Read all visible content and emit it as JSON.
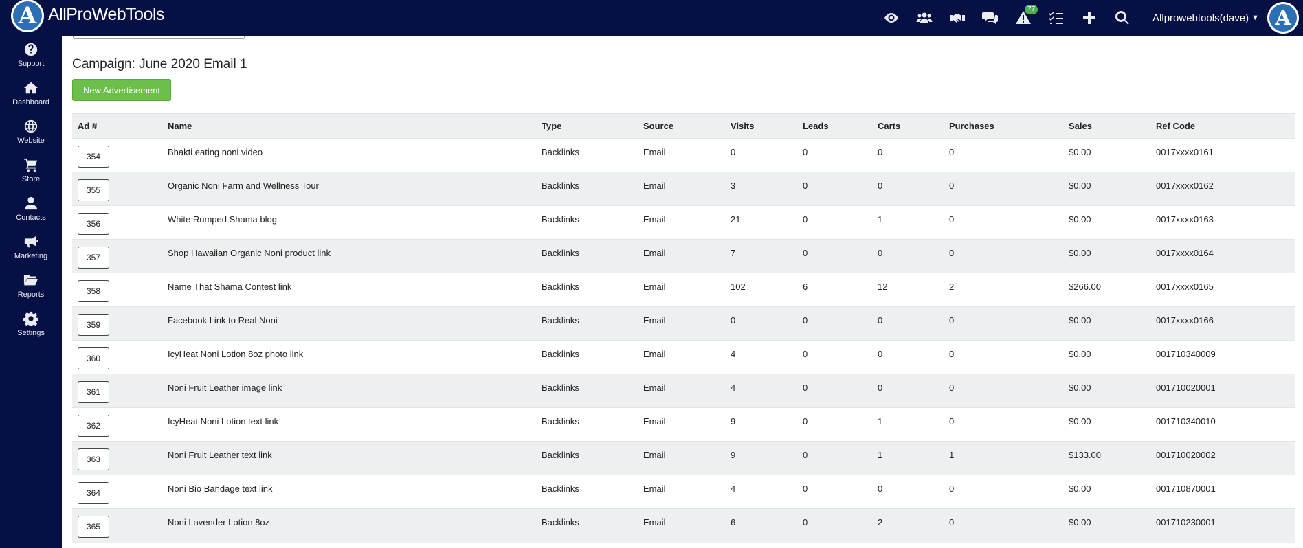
{
  "app": {
    "logo_text": "AllProWebTools",
    "logo_letter": "A"
  },
  "topbar": {
    "icons": [
      "eye-icon",
      "users-icon",
      "handshake-icon",
      "comments-icon",
      "alert-icon",
      "tasks-icon",
      "plus-icon",
      "search-icon"
    ],
    "alert_count": "77",
    "user_label": "Allprowebtools(dave)",
    "caret": "⌄"
  },
  "sidebar": {
    "items": [
      {
        "label": "Support",
        "icon": "question-circle-icon"
      },
      {
        "label": "Dashboard",
        "icon": "home-icon"
      },
      {
        "label": "Website",
        "icon": "globe-icon"
      },
      {
        "label": "Store",
        "icon": "cart-icon"
      },
      {
        "label": "Contacts",
        "icon": "user-icon"
      },
      {
        "label": "Marketing",
        "icon": "megaphone-icon"
      },
      {
        "label": "Reports",
        "icon": "folder-open-icon"
      },
      {
        "label": "Settings",
        "icon": "gear-icon"
      }
    ]
  },
  "page": {
    "title": "Campaign: June 2020 Email 1",
    "new_button": "New Advertisement"
  },
  "table": {
    "headers": [
      "Ad #",
      "Name",
      "Type",
      "Source",
      "Visits",
      "Leads",
      "Carts",
      "Purchases",
      "Sales",
      "Ref Code"
    ],
    "rows": [
      {
        "ad": "354",
        "name": "Bhakti eating noni video",
        "type": "Backlinks",
        "source": "Email",
        "visits": "0",
        "leads": "0",
        "carts": "0",
        "purchases": "0",
        "sales": "$0.00",
        "ref": "0017xxxx0161"
      },
      {
        "ad": "355",
        "name": "Organic Noni Farm and Wellness Tour",
        "type": "Backlinks",
        "source": "Email",
        "visits": "3",
        "leads": "0",
        "carts": "0",
        "purchases": "0",
        "sales": "$0.00",
        "ref": "0017xxxx0162"
      },
      {
        "ad": "356",
        "name": "White Rumped Shama blog",
        "type": "Backlinks",
        "source": "Email",
        "visits": "21",
        "leads": "0",
        "carts": "1",
        "purchases": "0",
        "sales": "$0.00",
        "ref": "0017xxxx0163"
      },
      {
        "ad": "357",
        "name": "Shop Hawaiian Organic Noni product link",
        "type": "Backlinks",
        "source": "Email",
        "visits": "7",
        "leads": "0",
        "carts": "0",
        "purchases": "0",
        "sales": "$0.00",
        "ref": "0017xxxx0164"
      },
      {
        "ad": "358",
        "name": "Name That Shama Contest link",
        "type": "Backlinks",
        "source": "Email",
        "visits": "102",
        "leads": "6",
        "carts": "12",
        "purchases": "2",
        "sales": "$266.00",
        "ref": "0017xxxx0165"
      },
      {
        "ad": "359",
        "name": "Facebook Link to Real Noni",
        "type": "Backlinks",
        "source": "Email",
        "visits": "0",
        "leads": "0",
        "carts": "0",
        "purchases": "0",
        "sales": "$0.00",
        "ref": "0017xxxx0166"
      },
      {
        "ad": "360",
        "name": "IcyHeat Noni Lotion 8oz photo link",
        "type": "Backlinks",
        "source": "Email",
        "visits": "4",
        "leads": "0",
        "carts": "0",
        "purchases": "0",
        "sales": "$0.00",
        "ref": "001710340009"
      },
      {
        "ad": "361",
        "name": "Noni Fruit Leather image link",
        "type": "Backlinks",
        "source": "Email",
        "visits": "4",
        "leads": "0",
        "carts": "0",
        "purchases": "0",
        "sales": "$0.00",
        "ref": "001710020001"
      },
      {
        "ad": "362",
        "name": "IcyHeat Noni Lotion text link",
        "type": "Backlinks",
        "source": "Email",
        "visits": "9",
        "leads": "0",
        "carts": "1",
        "purchases": "0",
        "sales": "$0.00",
        "ref": "001710340010"
      },
      {
        "ad": "363",
        "name": "Noni Fruit Leather text link",
        "type": "Backlinks",
        "source": "Email",
        "visits": "9",
        "leads": "0",
        "carts": "1",
        "purchases": "1",
        "sales": "$133.00",
        "ref": "001710020002"
      },
      {
        "ad": "364",
        "name": "Noni Bio Bandage text link",
        "type": "Backlinks",
        "source": "Email",
        "visits": "4",
        "leads": "0",
        "carts": "0",
        "purchases": "0",
        "sales": "$0.00",
        "ref": "001710870001"
      },
      {
        "ad": "365",
        "name": "Noni Lavender Lotion 8oz",
        "type": "Backlinks",
        "source": "Email",
        "visits": "6",
        "leads": "0",
        "carts": "2",
        "purchases": "0",
        "sales": "$0.00",
        "ref": "001710230001"
      }
    ]
  },
  "colors": {
    "nav_bg": "#071044",
    "accent_green": "#6cc04a",
    "source_green": "#5aab35",
    "row_stripe": "#edf0f1"
  }
}
